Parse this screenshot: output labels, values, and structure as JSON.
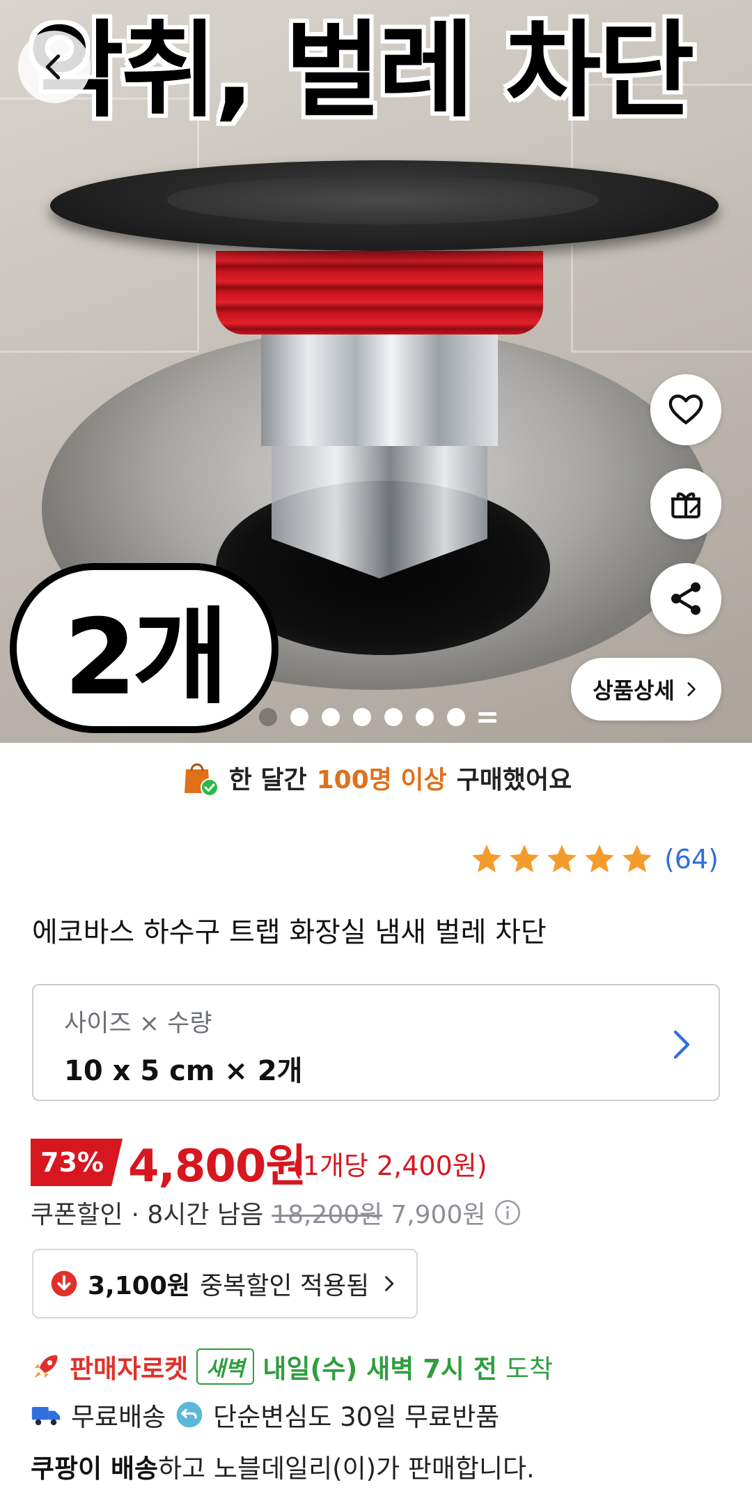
{
  "hero": {
    "headline": "악취, 벌레 차단",
    "count_badge": "2개",
    "detail_button_label": "상품상세",
    "gallery_total": 8,
    "gallery_current": 1
  },
  "purchase": {
    "prefix": "한 달간",
    "highlight": "100명 이상",
    "suffix": "구매했어요"
  },
  "rating": {
    "stars": 5,
    "count": "(64)"
  },
  "product": {
    "title": "에코바스 하수구 트랩 화장실 냄새 벌레 차단"
  },
  "option": {
    "label": "사이즈 × 수량",
    "value": "10 x 5 cm × 2개"
  },
  "price": {
    "discount_rate": "73%",
    "final_price": "4,800원",
    "unit_price": "(1개당 2,400원)",
    "coupon_label": "쿠폰할인",
    "time_left": "· 8시간 남음",
    "original_price": "18,200원",
    "pre_coupon_price": "7,900원"
  },
  "extra_discount": {
    "amount": "3,100원",
    "text": "중복할인 적용됨"
  },
  "delivery": {
    "rocket_label": "판매자로켓",
    "dawn_tag": "새벽",
    "arrival_bold": "내일(수) 새벽 7시 전",
    "arrival_suffix": "도착"
  },
  "shipping": {
    "free_shipping": "무료배송",
    "free_return": "단순변심도 30일 무료반품"
  },
  "seller": {
    "bold": "쿠팡이 배송",
    "rest": "하고 노블데일리(이)가 판매합니다."
  },
  "colors": {
    "accent_red": "#d8161f",
    "highlight_orange": "#e0701a",
    "rating_blue": "#2f6fde",
    "dawn_green": "#2e9e3e"
  }
}
